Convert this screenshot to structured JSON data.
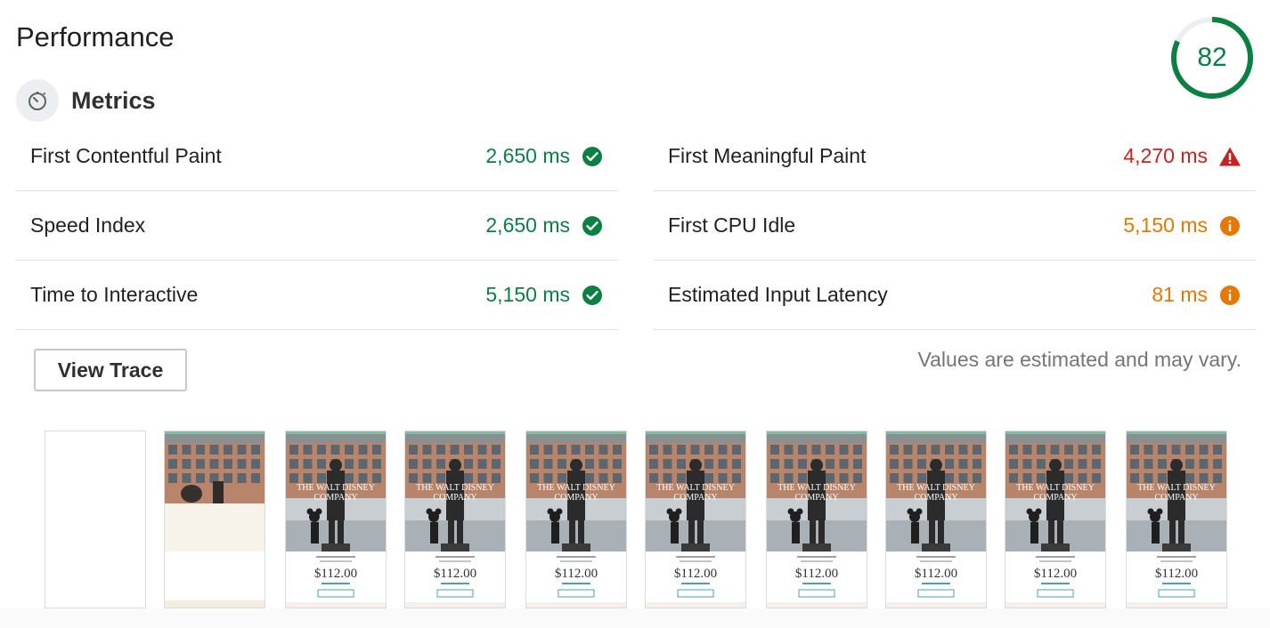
{
  "section_title": "Performance",
  "score": "82",
  "score_color": "#0b8043",
  "metrics_header": {
    "title": "Metrics",
    "icon": "stopwatch-icon"
  },
  "metrics_left": [
    {
      "label": "First Contentful Paint",
      "value": "2,650 ms",
      "status": "pass",
      "icon": "check-circle-icon"
    },
    {
      "label": "Speed Index",
      "value": "2,650 ms",
      "status": "pass",
      "icon": "check-circle-icon"
    },
    {
      "label": "Time to Interactive",
      "value": "5,150 ms",
      "status": "pass",
      "icon": "check-circle-icon"
    }
  ],
  "metrics_right": [
    {
      "label": "First Meaningful Paint",
      "value": "4,270 ms",
      "status": "fail",
      "icon": "warning-triangle-icon"
    },
    {
      "label": "First CPU Idle",
      "value": "5,150 ms",
      "status": "average",
      "icon": "info-circle-icon"
    },
    {
      "label": "Estimated Input Latency",
      "value": "81 ms",
      "status": "average",
      "icon": "info-circle-icon"
    }
  ],
  "status_colors": {
    "pass": "#0b8043",
    "fail": "#c7221f",
    "average": "#e67700"
  },
  "view_trace_label": "View Trace",
  "note": "Values are estimated and may vary.",
  "filmstrip": {
    "frames": [
      {
        "state": "blank"
      },
      {
        "state": "partial"
      },
      {
        "state": "complete"
      },
      {
        "state": "complete"
      },
      {
        "state": "complete"
      },
      {
        "state": "complete"
      },
      {
        "state": "complete"
      },
      {
        "state": "complete"
      },
      {
        "state": "complete"
      },
      {
        "state": "complete"
      }
    ],
    "thumbnail_text": {
      "heading_line1": "THE WALT DISNEY",
      "heading_line2": "COMPANY",
      "price": "$112.00"
    }
  }
}
